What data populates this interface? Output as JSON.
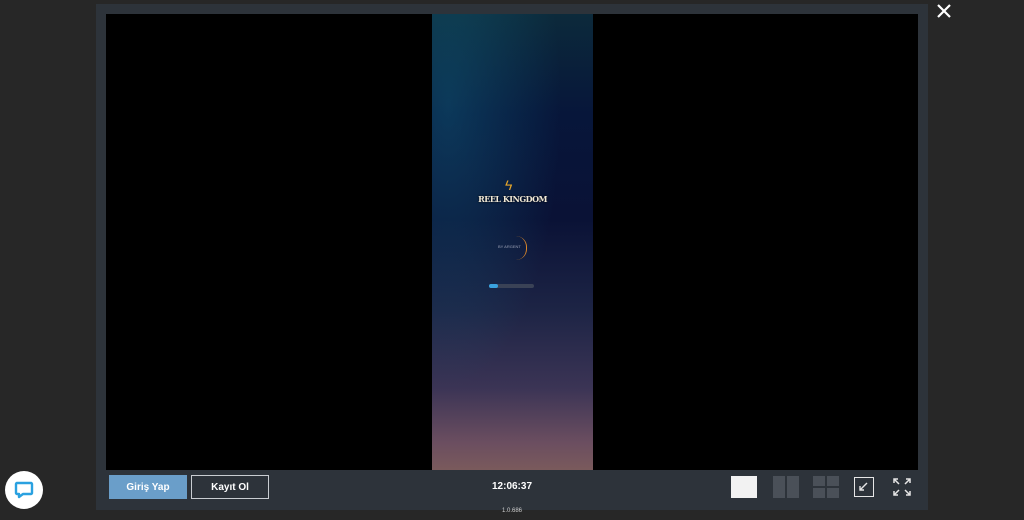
{
  "game": {
    "logo_text": "REEL KINGDOM",
    "tagline": "BY ARGENT",
    "loading_progress": 0.2
  },
  "toolbar": {
    "login_label": "Giriş Yap",
    "register_label": "Kayıt Ol",
    "clock": "12:06:37"
  },
  "footer": {
    "version": "1.0.686"
  },
  "icons": {
    "close": "close-icon",
    "chat": "chat-icon",
    "minimize": "minimize-icon",
    "fullscreen": "fullscreen-icon"
  },
  "colors": {
    "accent": "#6a9ec9",
    "loader": "#3aa2df",
    "chat": "#2aa1e0"
  }
}
